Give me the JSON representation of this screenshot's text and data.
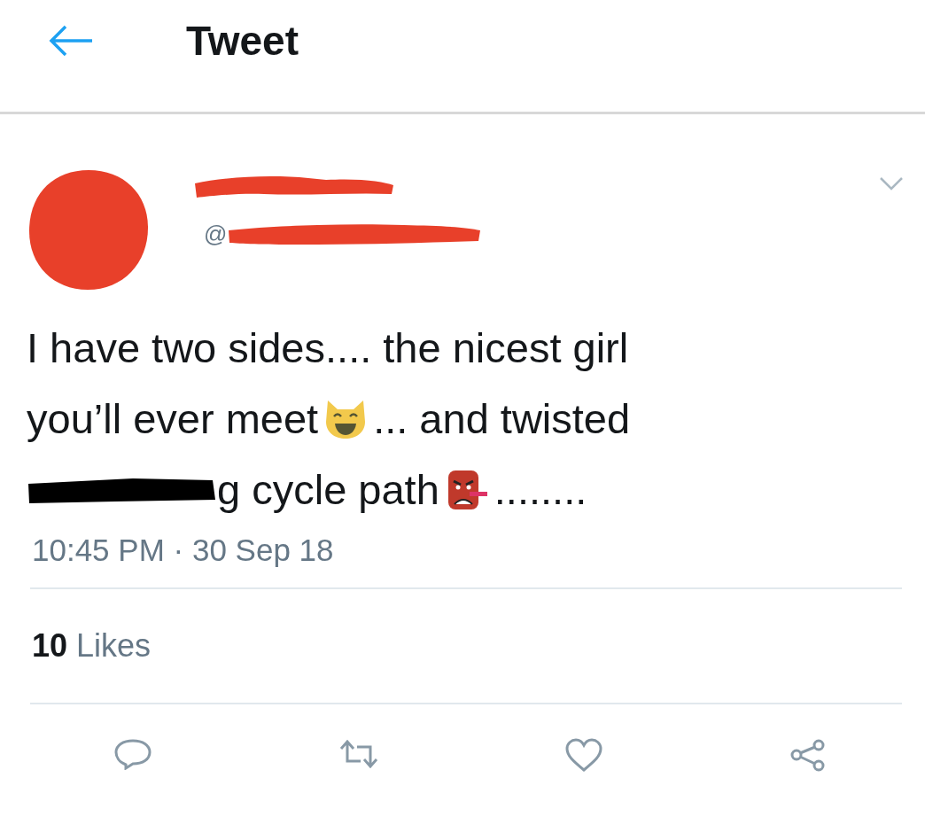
{
  "header": {
    "title": "Tweet"
  },
  "author": {
    "handle_prefix": "@"
  },
  "tweet_lines": [
    [
      {
        "kind": "text",
        "text": "I have two sides.... the nicest girl"
      }
    ],
    [
      {
        "kind": "text",
        "text": "you’ll ever meet"
      },
      {
        "kind": "cat_emoji"
      },
      {
        "kind": "text",
        "text": "... and twisted"
      }
    ],
    [
      {
        "kind": "redaction"
      },
      {
        "kind": "text",
        "text": "g cycle path"
      },
      {
        "kind": "goblin_emoji"
      },
      {
        "kind": "text",
        "text": "........"
      }
    ]
  ],
  "timestamp": "10:45 PM · 30 Sep 18",
  "likes": {
    "count": "10",
    "label": "Likes"
  }
}
